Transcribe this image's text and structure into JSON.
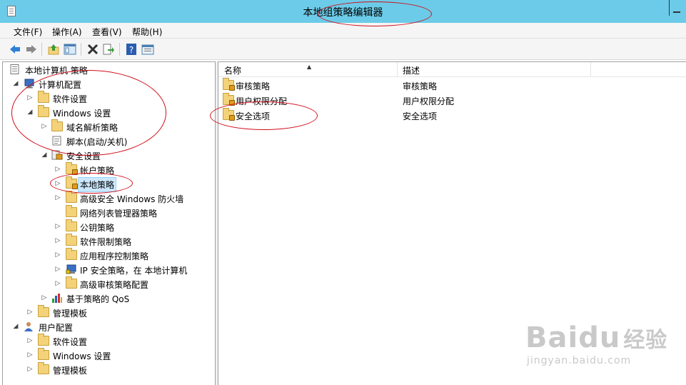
{
  "window": {
    "title": "本地组策略编辑器"
  },
  "menu": [
    {
      "label": "文件(F)"
    },
    {
      "label": "操作(A)"
    },
    {
      "label": "查看(V)"
    },
    {
      "label": "帮助(H)"
    }
  ],
  "toolbar": {
    "buttons": [
      "back-icon",
      "forward-icon",
      "up-folder-icon",
      "show-hide-tree-icon",
      "delete-icon",
      "export-icon",
      "help-icon",
      "properties-icon"
    ]
  },
  "tree": {
    "root": "本地计算机 策略",
    "computer_config": "计算机配置",
    "software_settings": "软件设置",
    "windows_settings": "Windows 设置",
    "name_resolution": "域名解析策略",
    "scripts": "脚本(启动/关机)",
    "security_settings": "安全设置",
    "account_policies": "帐户策略",
    "local_policies": "本地策略",
    "firewall": "高级安全 Windows 防火墙",
    "network_list": "网络列表管理器策略",
    "public_key": "公钥策略",
    "software_restriction": "软件限制策略",
    "app_control": "应用程序控制策略",
    "ip_security": "IP 安全策略，在 本地计算机",
    "advanced_audit": "高级审核策略配置",
    "qos": "基于策略的 QoS",
    "admin_templates": "管理模板",
    "user_config": "用户配置",
    "user_software_settings": "软件设置",
    "user_windows_settings": "Windows 设置",
    "user_admin_templates": "管理模板"
  },
  "list": {
    "col_name": "名称",
    "col_desc": "描述",
    "rows": [
      {
        "name": "审核策略",
        "desc": "审核策略"
      },
      {
        "name": "用户权限分配",
        "desc": "用户权限分配"
      },
      {
        "name": "安全选项",
        "desc": "安全选项"
      }
    ]
  },
  "watermark": {
    "brand": "Baidu",
    "brand_cn": "经验",
    "url": "jingyan.baidu.com"
  },
  "colors": {
    "titlebar": "#6ccbe8",
    "annotation": "#d0101a",
    "selection": "#cce8ff"
  }
}
